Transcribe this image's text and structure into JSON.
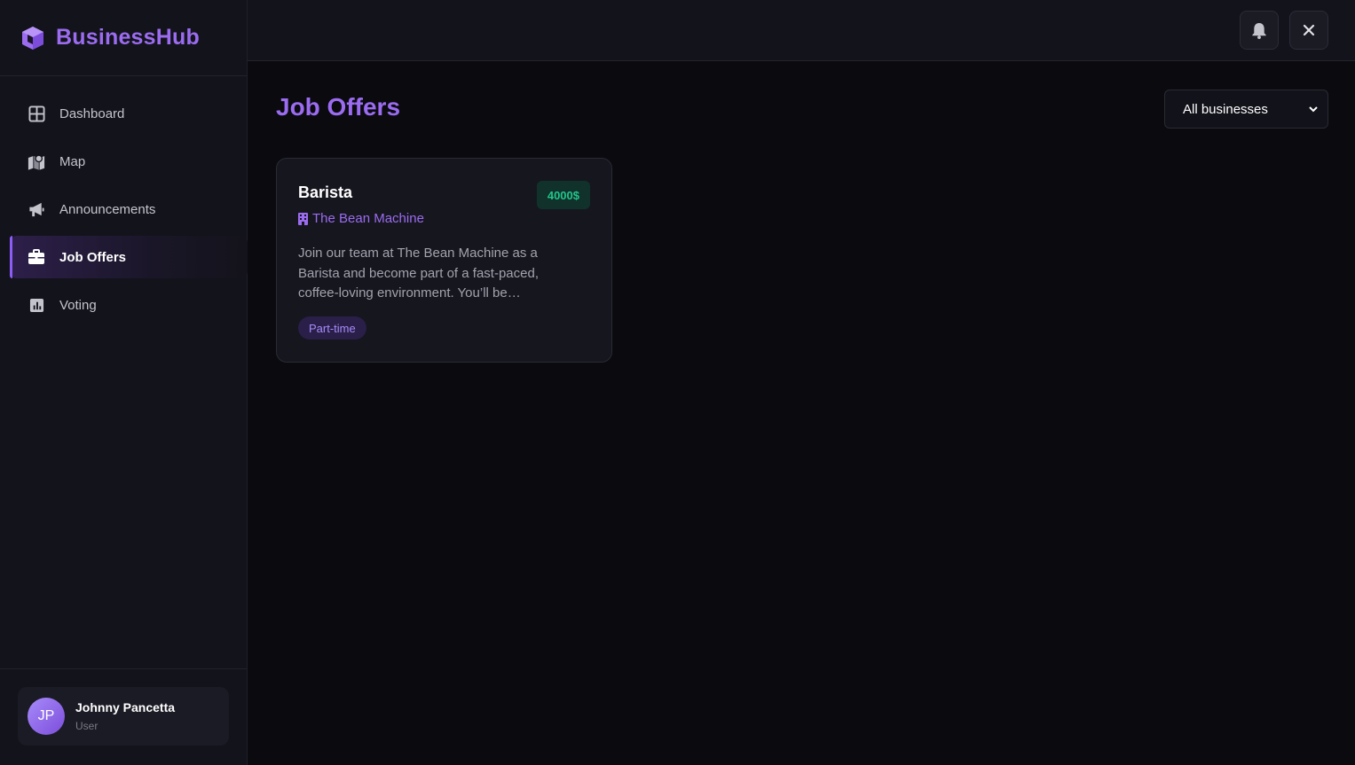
{
  "app": {
    "name": "BusinessHub"
  },
  "sidebar": {
    "items": [
      {
        "label": "Dashboard",
        "icon": "grid-icon"
      },
      {
        "label": "Map",
        "icon": "map-icon"
      },
      {
        "label": "Announcements",
        "icon": "megaphone-icon"
      },
      {
        "label": "Job Offers",
        "icon": "briefcase-icon",
        "active": true
      },
      {
        "label": "Voting",
        "icon": "chart-icon"
      }
    ]
  },
  "user": {
    "initials": "JP",
    "name": "Johnny Pancetta",
    "role": "User"
  },
  "topbar": {
    "buttons": [
      "bell-icon",
      "close-icon"
    ]
  },
  "main": {
    "title": "Job Offers",
    "filter": {
      "selected": "All businesses"
    },
    "jobs": [
      {
        "title": "Barista",
        "salary": "4000$",
        "company": "The Bean Machine",
        "description": "Join our team at The Bean Machine as a Barista and become part of a fast-paced, coffee-loving environment. You’ll be…",
        "tag": "Part-time"
      }
    ]
  },
  "colors": {
    "accent": "#9b6cf0",
    "background": "#0a0a0f",
    "sidebar": "#13131b",
    "salary": "#22c58b"
  }
}
